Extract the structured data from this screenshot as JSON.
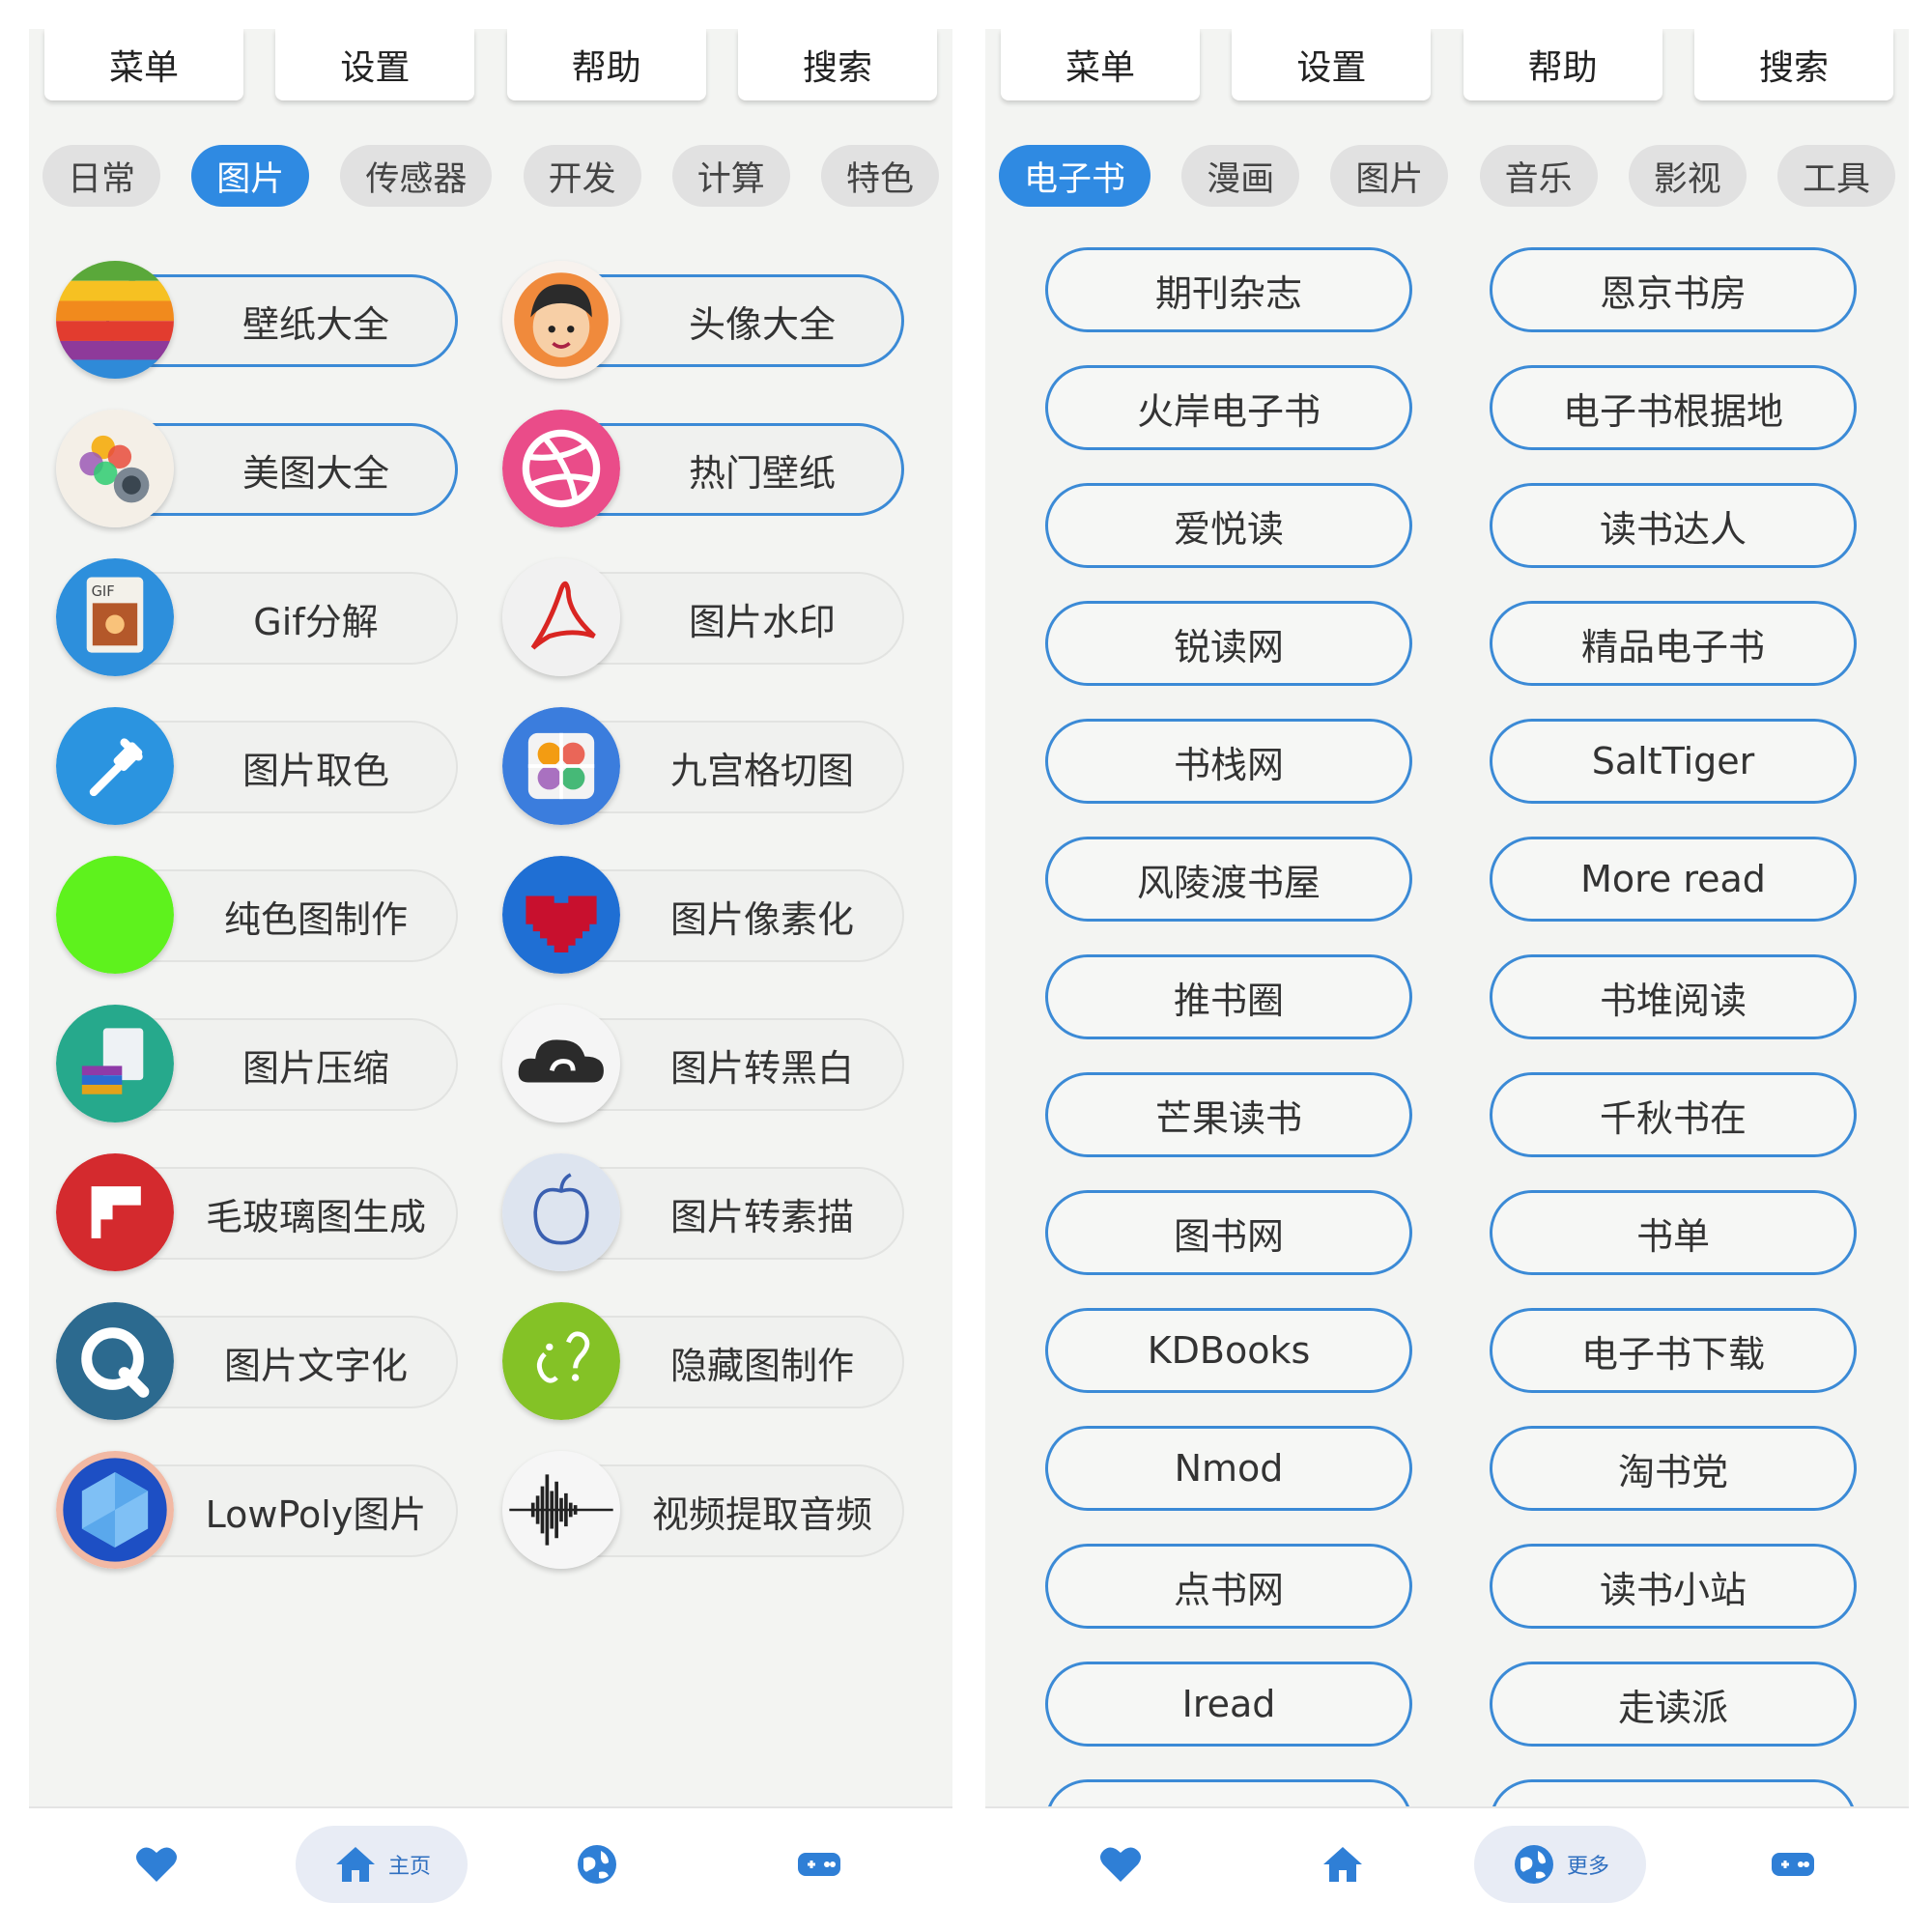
{
  "left_panel": {
    "menu": [
      "菜单",
      "设置",
      "帮助",
      "搜索"
    ],
    "categories": [
      "日常",
      "图片",
      "传感器",
      "开发",
      "计算",
      "特色"
    ],
    "active_category": "图片",
    "tools": [
      {
        "label": "壁纸大全",
        "icon": "rainbow-apple-icon"
      },
      {
        "label": "头像大全",
        "icon": "cartoon-avatar-icon"
      },
      {
        "label": "美图大全",
        "icon": "photos-camera-icon"
      },
      {
        "label": "热门壁纸",
        "icon": "dribbble-ball-icon"
      },
      {
        "label": "Gif分解",
        "icon": "gif-file-icon"
      },
      {
        "label": "图片水印",
        "icon": "acrobat-icon"
      },
      {
        "label": "图片取色",
        "icon": "eyedropper-icon"
      },
      {
        "label": "九宫格切图",
        "icon": "photos-grid-icon"
      },
      {
        "label": "纯色图制作",
        "icon": "green-circle-icon"
      },
      {
        "label": "图片像素化",
        "icon": "pixel-heart-icon"
      },
      {
        "label": "图片压缩",
        "icon": "compress-archive-icon"
      },
      {
        "label": "图片转黑白",
        "icon": "cloud-sync-icon"
      },
      {
        "label": "毛玻璃图生成",
        "icon": "flipboard-icon"
      },
      {
        "label": "图片转素描",
        "icon": "apple-sketch-icon"
      },
      {
        "label": "图片文字化",
        "icon": "q-letter-icon"
      },
      {
        "label": "隐藏图制作",
        "icon": "question-marks-icon"
      },
      {
        "label": "LowPoly图片",
        "icon": "lowpoly-gem-icon"
      },
      {
        "label": "视频提取音频",
        "icon": "audio-waveform-icon"
      }
    ],
    "nav": [
      "heart-icon",
      "home-icon",
      "globe-icon",
      "gamepad-icon"
    ],
    "nav_active_label": "主页"
  },
  "right_panel": {
    "menu": [
      "菜单",
      "设置",
      "帮助",
      "搜索"
    ],
    "categories": [
      "电子书",
      "漫画",
      "图片",
      "音乐",
      "影视",
      "工具"
    ],
    "active_category": "电子书",
    "links": [
      "期刊杂志",
      "恩京书房",
      "火岸电子书",
      "电子书根据地",
      "爱悦读",
      "读书达人",
      "锐读网",
      "精品电子书",
      "书栈网",
      "SaltTiger",
      "风陵渡书屋",
      "More read",
      "推书圈",
      "书堆阅读",
      "芒果读书",
      "千秋书在",
      "图书网",
      "书单",
      "KDBooks",
      "电子书下载",
      "Nmod",
      "淘书党",
      "点书网",
      "读书小站",
      "Iread",
      "走读派",
      "",
      ""
    ],
    "nav": [
      "heart-icon",
      "home-icon",
      "globe-icon",
      "gamepad-icon"
    ],
    "nav_active_label": "更多"
  },
  "colors": {
    "accent": "#2f8ae2",
    "border": "#3b8ad6",
    "background": "#f3f4f2"
  }
}
